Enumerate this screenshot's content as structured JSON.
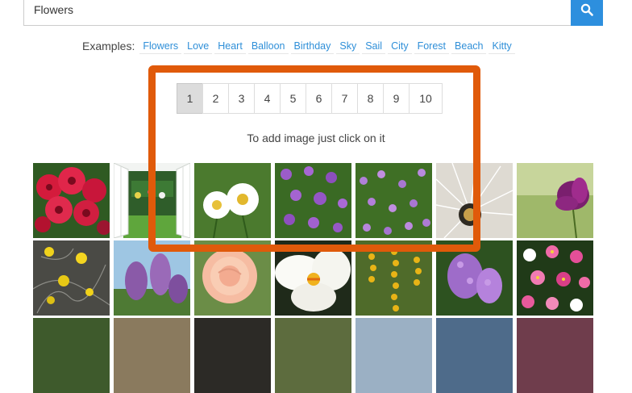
{
  "search": {
    "value": "Flowers",
    "button_icon": "search-icon"
  },
  "examples": {
    "label": "Examples:",
    "items": [
      "Flowers",
      "Love",
      "Heart",
      "Balloon",
      "Birthday",
      "Sky",
      "Sail",
      "City",
      "Forest",
      "Beach",
      "Kitty"
    ]
  },
  "pagination": {
    "pages": [
      "1",
      "2",
      "3",
      "4",
      "5",
      "6",
      "7",
      "8",
      "9",
      "10"
    ],
    "active": "1"
  },
  "hint": "To add image just click on it",
  "colors": {
    "accent": "#2d8fde",
    "link": "#2f8fd8",
    "highlight": "#e05a0a"
  }
}
